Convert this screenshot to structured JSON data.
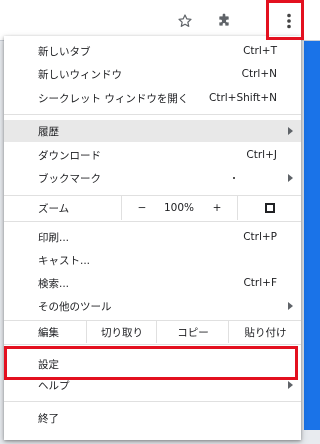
{
  "toolbar": {
    "star_icon": "star-icon",
    "extensions_icon": "puzzle-icon",
    "more_icon": "vertical-dots-icon",
    "highlight_color": "#e3101f"
  },
  "menu": {
    "new_tab": {
      "label": "新しいタブ",
      "shortcut": "Ctrl+T"
    },
    "new_window": {
      "label": "新しいウィンドウ",
      "shortcut": "Ctrl+N"
    },
    "incognito": {
      "label": "シークレット ウィンドウを開く",
      "shortcut": "Ctrl+Shift+N"
    },
    "history": {
      "label": "履歴"
    },
    "downloads": {
      "label": "ダウンロード",
      "shortcut": "Ctrl+J"
    },
    "bookmarks": {
      "label": "ブックマーク"
    },
    "zoom": {
      "label": "ズーム",
      "minus": "−",
      "value": "100%",
      "plus": "+"
    },
    "print": {
      "label": "印刷...",
      "shortcut": "Ctrl+P"
    },
    "cast": {
      "label": "キャスト..."
    },
    "find": {
      "label": "検索...",
      "shortcut": "Ctrl+F"
    },
    "more_tools": {
      "label": "その他のツール"
    },
    "edit": {
      "label": "編集",
      "cut": "切り取り",
      "copy": "コピー",
      "paste": "貼り付け"
    },
    "settings": {
      "label": "設定"
    },
    "help": {
      "label": "ヘルプ"
    },
    "exit": {
      "label": "終了"
    }
  }
}
